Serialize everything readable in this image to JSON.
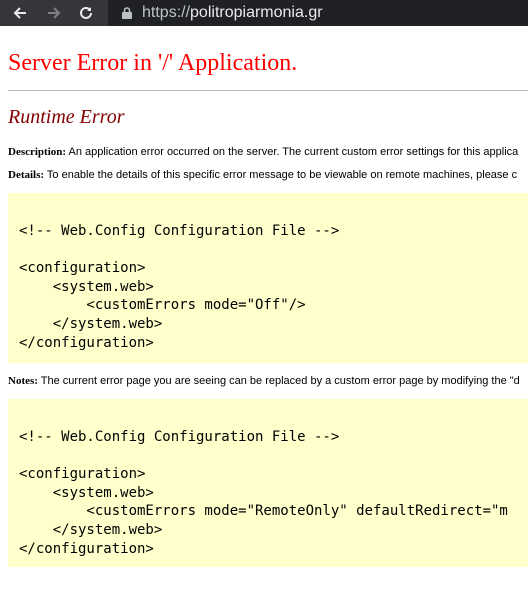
{
  "browser": {
    "url_scheme": "https://",
    "url_host": "politropiarmonia.gr"
  },
  "page": {
    "title": "Server Error in '/' Application.",
    "subtitle": "Runtime Error",
    "description_label": "Description:",
    "description_text": " An application error occurred on the server. The current custom error settings for this applica",
    "details_label": "Details:",
    "details_text": " To enable the details of this specific error message to be viewable on remote machines, please c",
    "code1": "<!-- Web.Config Configuration File -->\n\n<configuration>\n    <system.web>\n        <customErrors mode=\"Off\"/>\n    </system.web>\n</configuration>",
    "notes_label": "Notes:",
    "notes_text": " The current error page you are seeing can be replaced by a custom error page by modifying the \"d",
    "code2": "<!-- Web.Config Configuration File -->\n\n<configuration>\n    <system.web>\n        <customErrors mode=\"RemoteOnly\" defaultRedirect=\"m\n    </system.web>\n</configuration>"
  },
  "colors": {
    "title": "#ff0000",
    "subtitle": "#800000",
    "code_background": "#ffffcc",
    "toolbar": "#35363a"
  },
  "icons": [
    "back-arrow-icon",
    "forward-arrow-icon",
    "reload-icon",
    "lock-icon"
  ]
}
